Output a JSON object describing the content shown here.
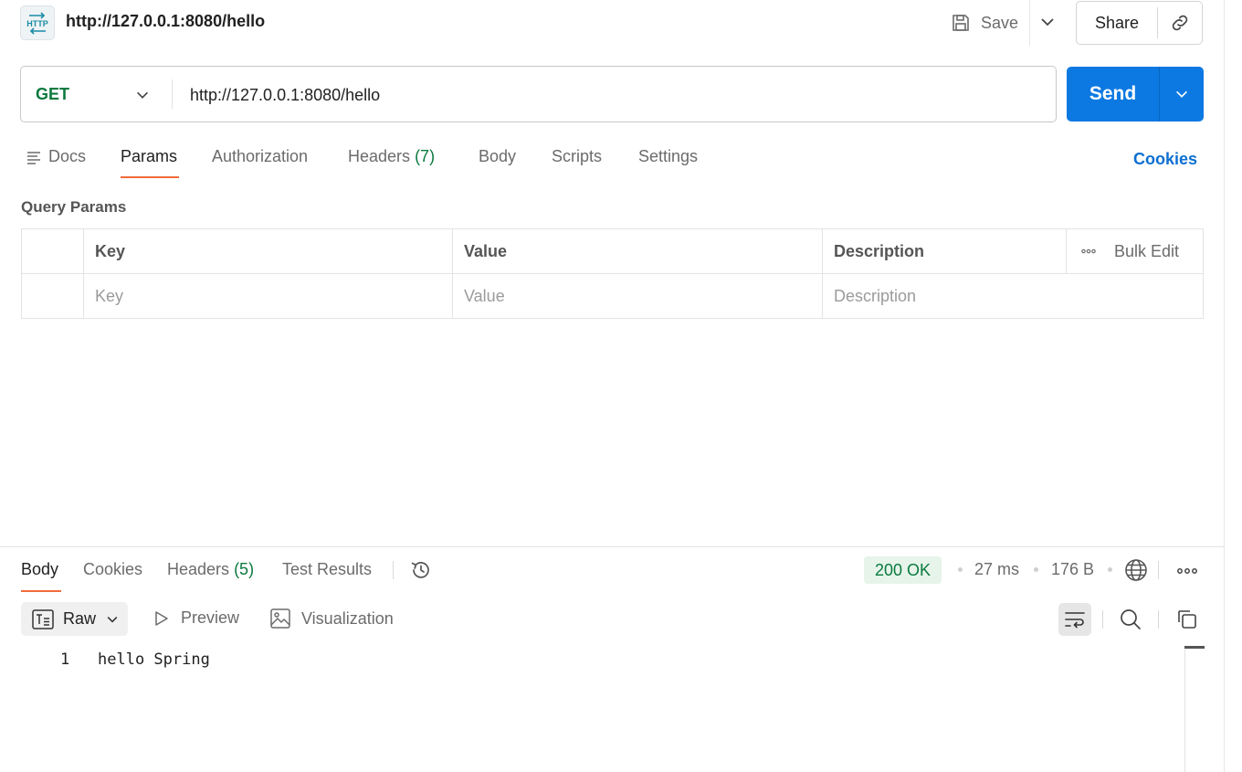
{
  "header": {
    "badge_text": "HTTP",
    "title": "http://127.0.0.1:8080/hello",
    "save_label": "Save",
    "share_label": "Share"
  },
  "request": {
    "method": "GET",
    "url": "http://127.0.0.1:8080/hello",
    "send_label": "Send"
  },
  "request_tabs": {
    "docs": "Docs",
    "params": "Params",
    "authorization": "Authorization",
    "headers": "Headers",
    "headers_count": "(7)",
    "body": "Body",
    "scripts": "Scripts",
    "settings": "Settings",
    "cookies": "Cookies",
    "active": "Params"
  },
  "query_params": {
    "title": "Query Params",
    "columns": [
      "Key",
      "Value",
      "Description"
    ],
    "placeholders": [
      "Key",
      "Value",
      "Description"
    ],
    "bulk_edit": "Bulk Edit"
  },
  "response": {
    "tabs": {
      "body": "Body",
      "cookies": "Cookies",
      "headers": "Headers",
      "headers_count": "(5)",
      "test_results": "Test Results",
      "active": "Body"
    },
    "status": "200 OK",
    "time": "27 ms",
    "size": "176 B",
    "format": "Raw",
    "preview": "Preview",
    "visualization": "Visualization",
    "lines": [
      {
        "number": "1",
        "text": "hello Spring"
      }
    ]
  },
  "colors": {
    "accent_orange": "#f26b3a",
    "send_blue": "#0c79e2",
    "method_green": "#0b7a3e",
    "cookies_blue": "#0c6fd1",
    "status_bg": "#e6f4ea"
  },
  "icons": [
    "http-icon",
    "save-icon",
    "chevron-down-icon",
    "link-icon",
    "docs-icon",
    "more-horizontal-icon",
    "history-icon",
    "globe-icon",
    "raw-format-icon",
    "play-icon",
    "image-icon",
    "wrap-lines-icon",
    "search-icon",
    "copy-icon"
  ]
}
